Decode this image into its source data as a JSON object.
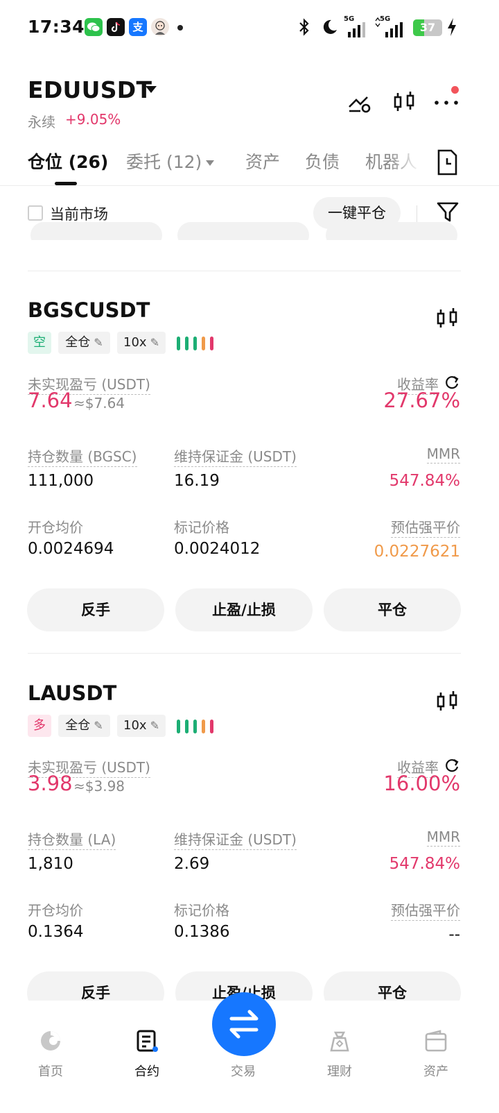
{
  "status_bar": {
    "time": "17:34",
    "battery": "37",
    "battery_level": 0.37,
    "network_1": "5G",
    "network_2": "5G",
    "app_icons": [
      "wechat-icon",
      "tiktok-icon",
      "alipay-icon",
      "avatar-icon"
    ]
  },
  "header": {
    "pair": "EDUUSDT",
    "type": "永续",
    "change": "+9.05%"
  },
  "tabs": [
    {
      "label": "仓位 (26)",
      "active": true
    },
    {
      "label": "委托 (12)",
      "active": false
    },
    {
      "label": "资产",
      "active": false
    },
    {
      "label": "负债",
      "active": false
    },
    {
      "label": "机器人",
      "active": false
    }
  ],
  "filter": {
    "current_market_label": "当前市场",
    "close_all_label": "一键平仓"
  },
  "positions": [
    {
      "symbol": "BGSCUSDT",
      "side": "空",
      "margin_mode": "全仓",
      "leverage": "10x",
      "pnl_label": "未实现盈亏 (USDT)",
      "pnl": "7.64",
      "pnl_usd": "≈$7.64",
      "roe_label": "收益率",
      "roe": "27.67%",
      "qty_label": "持仓数量 (BGSC)",
      "qty": "111,000",
      "margin_label": "维持保证金 (USDT)",
      "margin": "16.19",
      "mmr_label": "MMR",
      "mmr": "547.84%",
      "entry_label": "开仓均价",
      "entry": "0.0024694",
      "mark_label": "标记价格",
      "mark": "0.0024012",
      "liq_label": "预估强平价",
      "liq": "0.0227621",
      "btn_reverse": "反手",
      "btn_tpsl": "止盈/止损",
      "btn_close": "平仓"
    },
    {
      "symbol": "LAUSDT",
      "side": "多",
      "margin_mode": "全仓",
      "leverage": "10x",
      "pnl_label": "未实现盈亏 (USDT)",
      "pnl": "3.98",
      "pnl_usd": "≈$3.98",
      "roe_label": "收益率",
      "roe": "16.00%",
      "qty_label": "持仓数量 (LA)",
      "qty": "1,810",
      "margin_label": "维持保证金 (USDT)",
      "margin": "2.69",
      "mmr_label": "MMR",
      "mmr": "547.84%",
      "entry_label": "开仓均价",
      "entry": "0.1364",
      "mark_label": "标记价格",
      "mark": "0.1386",
      "liq_label": "预估强平价",
      "liq": "--",
      "btn_reverse": "反手",
      "btn_tpsl": "止盈/止损",
      "btn_close": "平仓"
    }
  ],
  "bottom_nav": [
    {
      "label": "首页",
      "icon": "home-icon",
      "active": false
    },
    {
      "label": "合约",
      "icon": "contract-icon",
      "active": true
    },
    {
      "label": "交易",
      "icon": "swap-icon",
      "active": false
    },
    {
      "label": "理财",
      "icon": "earn-icon",
      "active": false
    },
    {
      "label": "资产",
      "icon": "wallet-icon",
      "active": false
    }
  ],
  "colors": {
    "pink": "#e2386b",
    "green": "#1cae74",
    "orange": "#f09a4a",
    "blue": "#1677ff",
    "risk_bars": [
      "#1cae74",
      "#1cae74",
      "#1cae74",
      "#f09a4a",
      "#e2386b"
    ]
  }
}
